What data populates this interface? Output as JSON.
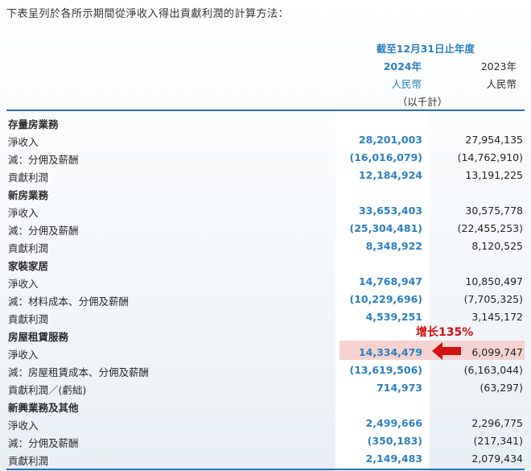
{
  "intro": "下表呈列於各所示期間從淨收入得出貢獻利潤的計算方法：",
  "header": {
    "period": "截至12月31日止年度",
    "year_2024": "2024年",
    "year_2023": "2023年",
    "currency_2024": "人民幣",
    "currency_2023": "人民幣",
    "unit": "（以千計）"
  },
  "rows": [
    {
      "label": "存量房業務",
      "type": "section",
      "v2024": "",
      "v2023": ""
    },
    {
      "label": "淨收入",
      "type": "item",
      "v2024": "28,201,003",
      "v2023": "27,954,135"
    },
    {
      "label": "減：分佣及薪酬",
      "type": "item",
      "v2024": "(16,016,079)",
      "v2023": "(14,762,910)"
    },
    {
      "label": "貢獻利潤",
      "type": "item",
      "v2024": "12,184,924",
      "v2023": "13,191,225"
    },
    {
      "label": "新房業務",
      "type": "section",
      "v2024": "",
      "v2023": ""
    },
    {
      "label": "淨收入",
      "type": "item",
      "v2024": "33,653,403",
      "v2023": "30,575,778"
    },
    {
      "label": "減：分佣及薪酬",
      "type": "item",
      "v2024": "(25,304,481)",
      "v2023": "(22,455,253)"
    },
    {
      "label": "貢獻利潤",
      "type": "item",
      "v2024": "8,348,922",
      "v2023": "8,120,525"
    },
    {
      "label": "家裝家居",
      "type": "section",
      "v2024": "",
      "v2023": ""
    },
    {
      "label": "淨收入",
      "type": "item",
      "v2024": "14,768,947",
      "v2023": "10,850,497"
    },
    {
      "label": "減：材料成本、分佣及薪酬",
      "type": "item",
      "v2024": "(10,229,696)",
      "v2023": "(7,705,325)"
    },
    {
      "label": "貢獻利潤",
      "type": "item",
      "v2024": "4,539,251",
      "v2023": "3,145,172"
    },
    {
      "label": "房屋租賃服務",
      "type": "section",
      "v2024": "",
      "v2023": ""
    },
    {
      "label": "淨收入",
      "type": "item",
      "v2024": "14,334,479",
      "v2023": "6,099,747"
    },
    {
      "label": "減：房屋租賃成本、分佣及薪酬",
      "type": "item",
      "v2024": "(13,619,506)",
      "v2023": "(6,163,044)"
    },
    {
      "label": "貢獻利潤／(虧絀)",
      "type": "item",
      "v2024": "714,973",
      "v2023": "(63,297)"
    },
    {
      "label": "新興業務及其他",
      "type": "section",
      "v2024": "",
      "v2023": ""
    },
    {
      "label": "淨收入",
      "type": "item",
      "v2024": "2,499,666",
      "v2023": "2,296,775"
    },
    {
      "label": "減：分佣及薪酬",
      "type": "item",
      "v2024": "(350,183)",
      "v2023": "(217,341)"
    },
    {
      "label": "貢獻利潤",
      "type": "item",
      "v2024": "2,149,483",
      "v2023": "2,079,434"
    }
  ],
  "annotation": {
    "note": "增长135%",
    "arrow_icon": "arrow-left-icon",
    "color": "#d11010",
    "highlight_color": "#f5d2d0"
  },
  "colors": {
    "accent": "#2c7fc0",
    "rule": "#2c6fb0"
  }
}
